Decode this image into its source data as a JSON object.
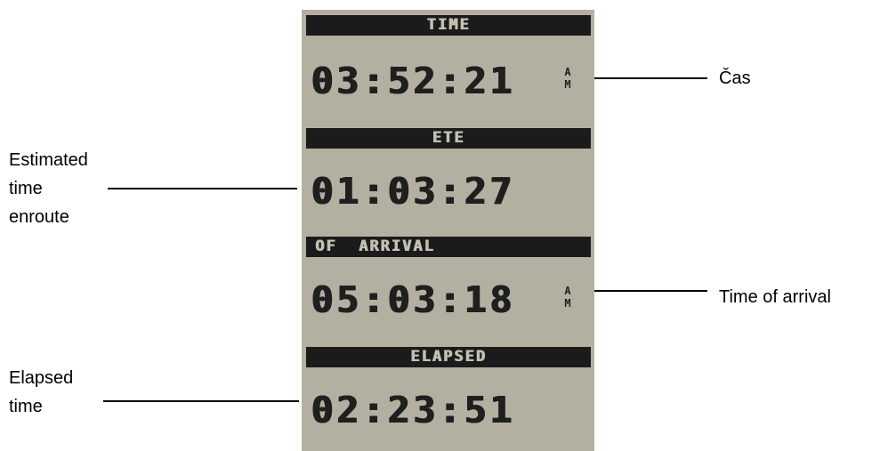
{
  "display": {
    "time": {
      "header": "TIME",
      "value": "03:52:21",
      "suffix_top": "A",
      "suffix_bottom": "M"
    },
    "ete": {
      "header": "ETE",
      "value": "01:03:27"
    },
    "arrival": {
      "header": "OF  ARRIVAL",
      "value": "05:03:18",
      "suffix_top": "A",
      "suffix_bottom": "M"
    },
    "elapsed": {
      "header": "ELAPSED",
      "value": "02:23:51"
    }
  },
  "callouts": {
    "cas": "Čas",
    "estimated": [
      "Estimated",
      "time",
      "enroute"
    ],
    "time_of_arrival": "Time of arrival",
    "elapsed": [
      "Elapsed",
      "time"
    ]
  },
  "colors": {
    "lcd_background": "#b4b0a1",
    "bar": "#1b1b1b",
    "text": "#1f1f1f"
  }
}
